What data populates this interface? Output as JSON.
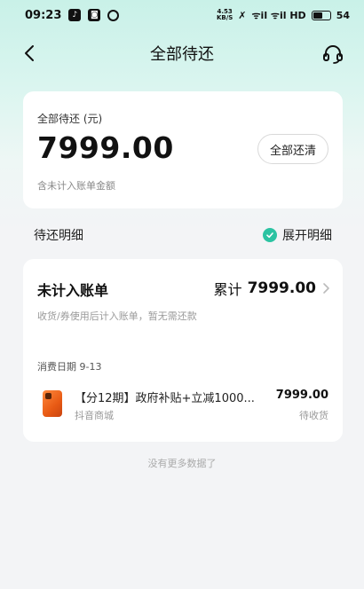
{
  "status_bar": {
    "time": "09:23",
    "net_speed_top": "4.53",
    "net_speed_bottom": "KB/S",
    "signal_text": "ᯤil ᯤil HD",
    "battery": "54"
  },
  "nav": {
    "title": "全部待还"
  },
  "summary": {
    "label": "全部待还 (元)",
    "amount": "7999.00",
    "note": "含未计入账单金额",
    "repay_all_label": "全部还清"
  },
  "details": {
    "title": "待还明细",
    "expand_label": "展开明细"
  },
  "bill": {
    "title": "未计入账单",
    "sum_label": "累计",
    "sum_value": "7999.00",
    "subtitle": "收货/券使用后计入账单，暂无需还款",
    "consume_date": "消费日期 9-13",
    "item": {
      "title": "【分12期】政府补贴+立减1000...",
      "price": "7999.00",
      "shop": "抖音商城",
      "status": "待收货"
    }
  },
  "footer": {
    "no_more": "没有更多数据了"
  },
  "colors": {
    "accent": "#2bc3a2",
    "header_gradient_top": "#c9f1e8"
  }
}
